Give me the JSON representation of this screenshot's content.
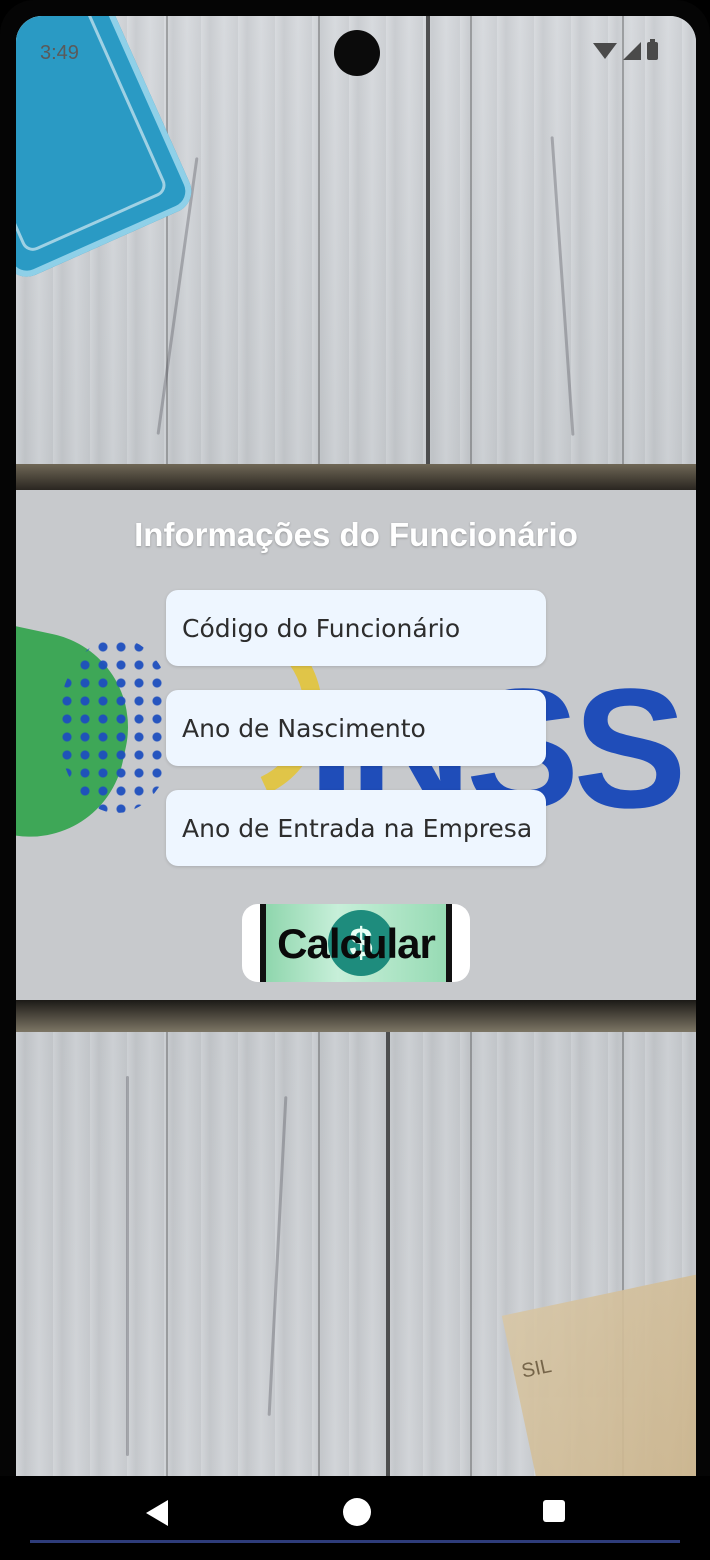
{
  "status_bar": {
    "time": "3:49"
  },
  "form": {
    "title": "Informações do Funcionário",
    "fields": [
      {
        "placeholder": "Código do Funcionário",
        "value": ""
      },
      {
        "placeholder": "Ano de Nascimento",
        "value": ""
      },
      {
        "placeholder": "Ano de Entrada na Empresa",
        "value": ""
      }
    ],
    "submit_label": "Calcular",
    "submit_icon": "dollar-coin-icon"
  },
  "background": {
    "logo_text": "INSS",
    "banknote_text": "SIL"
  },
  "nav_bar": {
    "back_icon": "back-triangle-icon",
    "home_icon": "home-circle-icon",
    "recents_icon": "recents-square-icon"
  },
  "colors": {
    "input_bg": "#eef6ff",
    "logo_blue": "#1747b8",
    "logo_green": "#2fa34a",
    "logo_yellow": "#e5c531",
    "button_bg": "#ffffff"
  }
}
